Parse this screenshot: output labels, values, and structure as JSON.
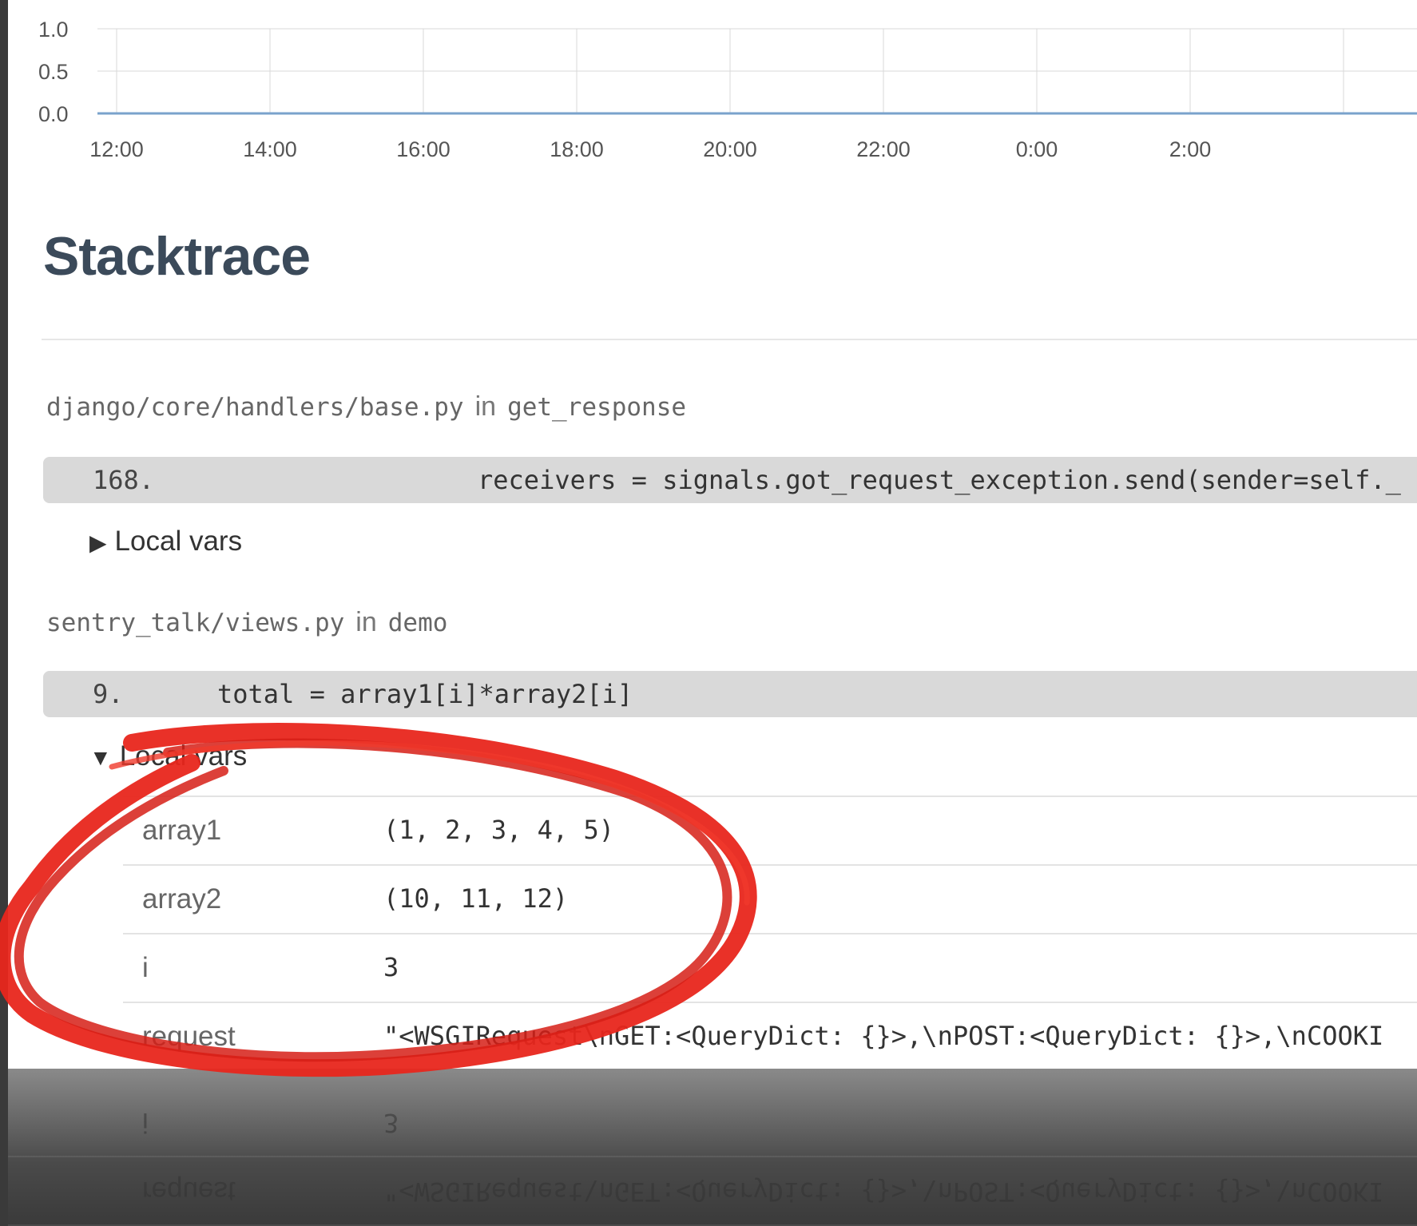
{
  "chart": {
    "y_ticks": [
      "1.0",
      "0.5",
      "0.0"
    ],
    "x_ticks": [
      "12:00",
      "14:00",
      "16:00",
      "18:00",
      "20:00",
      "22:00",
      "0:00",
      "2:00"
    ],
    "colors": {
      "grid": "#d8d8d8",
      "series": "#7aa3cc",
      "axis_text": "#555555"
    }
  },
  "chart_data": {
    "type": "line",
    "x": [
      "12:00",
      "14:00",
      "16:00",
      "18:00",
      "20:00",
      "22:00",
      "0:00",
      "2:00"
    ],
    "series": [
      {
        "values": [
          0,
          0,
          0,
          0,
          0,
          0,
          0,
          0
        ]
      }
    ],
    "y_ticks": [
      1.0,
      0.5,
      0.0
    ],
    "ylim": [
      0,
      1.0
    ],
    "grid": true
  },
  "page": {
    "title": "Stacktrace",
    "in_word": "in"
  },
  "frames": [
    {
      "file": "django/core/handlers/base.py",
      "function": "get_response",
      "line_no": "168.",
      "code": "receivers = signals.got_request_exception.send(sender=self._",
      "toggle": "Local vars",
      "expanded": false
    },
    {
      "file": "sentry_talk/views.py",
      "function": "demo",
      "line_no": "9.",
      "code": "total = array1[i]*array2[i]",
      "toggle": "Local vars",
      "expanded": true,
      "vars": [
        {
          "key": "array1",
          "value": "(1, 2, 3, 4, 5)"
        },
        {
          "key": "array2",
          "value": "(10, 11, 12)"
        },
        {
          "key": "i",
          "value": "3"
        },
        {
          "key": "request",
          "value": "\"<WSGIRequest\\nGET:<QueryDict: {}>,\\nPOST:<QueryDict: {}>,\\nCOOKI"
        }
      ]
    }
  ],
  "annotation": {
    "type": "hand-drawn-circle",
    "color": "#e8261c"
  }
}
